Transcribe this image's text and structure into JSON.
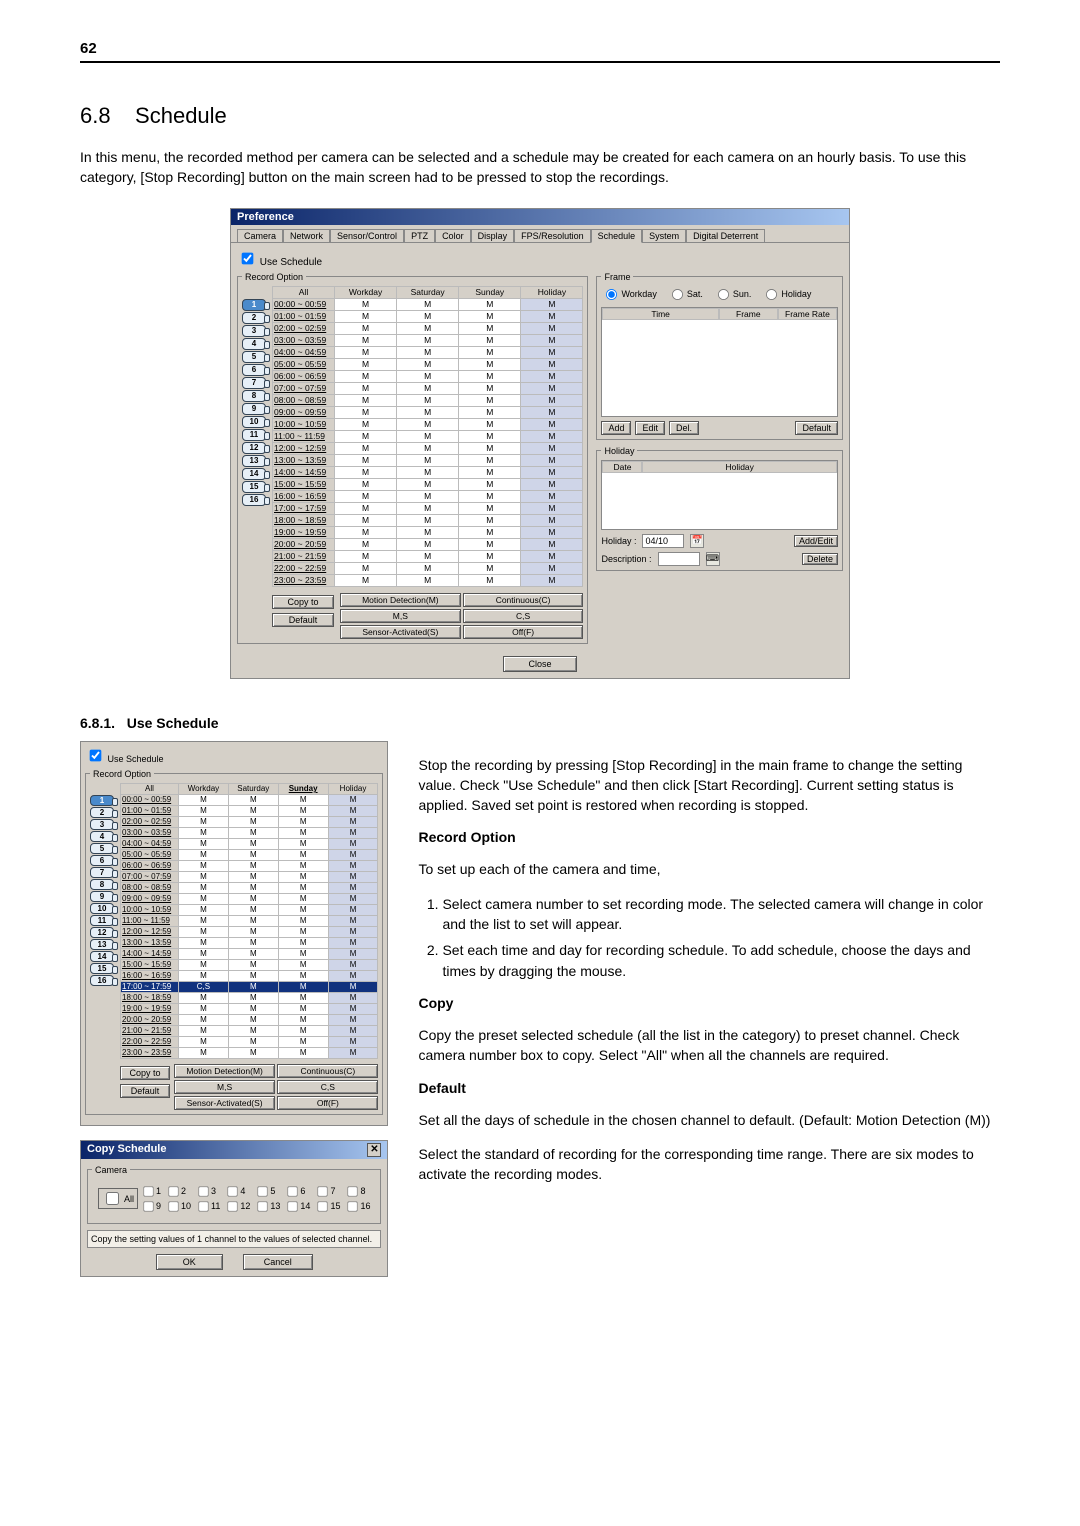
{
  "page_number": "62",
  "section": {
    "num": "6.8",
    "title": "Schedule"
  },
  "intro": "In this menu, the recorded method per camera can be selected and a schedule may be created for each camera on an hourly basis. To use this category, [Stop Recording] button on the main screen had to be pressed to stop the recordings.",
  "subsect": {
    "num": "6.8.1.",
    "title": "Use Schedule"
  },
  "right": {
    "p1": "Stop the recording by pressing [Stop Recording] in the main frame to change the setting value. Check \"Use Schedule\" and then click [Start Recording]. Current setting status is applied. Saved set point is restored when recording is stopped.",
    "record_option_h": "Record Option",
    "record_option_p": "To set up each of the camera and time,",
    "list": [
      "Select camera number to set recording mode. The selected camera will change in color and the list to set will appear.",
      "Set each time and day for recording schedule. To add schedule, choose the days and times by dragging the mouse."
    ],
    "copy_h": "Copy",
    "copy_p": "Copy the preset selected schedule (all the list in the category) to preset channel. Check camera number box to copy. Select \"All\" when all the channels are required.",
    "default_h": "Default",
    "default_p": "Set all the days of schedule in the chosen channel to default. (Default: Motion Detection (M))",
    "tail": "Select the standard of recording for the corresponding time range. There are six modes to activate the recording modes."
  },
  "dialog": {
    "title": "Preference",
    "tabs": [
      "Camera",
      "Network",
      "Sensor/Control",
      "PTZ",
      "Color",
      "Display",
      "FPS/Resolution",
      "Schedule",
      "System",
      "Digital Deterrent"
    ],
    "active_tab": "Schedule",
    "use_schedule": "Use Schedule",
    "record_option": "Record Option",
    "cols": [
      "All",
      "Workday",
      "Saturday",
      "Sunday",
      "Holiday"
    ],
    "copy_to": "Copy to",
    "default_btn": "Default",
    "legend": {
      "md": "Motion Detection(M)",
      "cont": "Continuous(C)",
      "ms": "M,S",
      "cs": "C,S",
      "sa": "Sensor-Activated(S)",
      "off": "Off(F)"
    },
    "frame_grp": "Frame",
    "radios": {
      "workday": "Workday",
      "sat": "Sat.",
      "sun": "Sun.",
      "holiday": "Holiday"
    },
    "frame_cols": {
      "time": "Time",
      "frame": "Frame",
      "rate": "Frame Rate"
    },
    "frame_btns": {
      "add": "Add",
      "edit": "Edit",
      "del": "Del.",
      "default": "Default"
    },
    "holiday_grp": "Holiday",
    "holiday_cols": {
      "date": "Date",
      "holiday": "Holiday"
    },
    "holiday_label": "Holiday :",
    "holiday_value": "04/10",
    "desc_label": "Description :",
    "addedit": "Add/Edit",
    "delete": "Delete",
    "close": "Close"
  },
  "mini_dialog": {
    "selected_row": 17,
    "selected_val": "C,S"
  },
  "copy_dialog": {
    "title": "Copy Schedule",
    "camera_grp": "Camera",
    "all": "All",
    "msg": "Copy the setting values of  1 channel to the values of selected channel.",
    "ok": "OK",
    "cancel": "Cancel"
  },
  "times": [
    "00:00 ~ 00:59",
    "01:00 ~ 01:59",
    "02:00 ~ 02:59",
    "03:00 ~ 03:59",
    "04:00 ~ 04:59",
    "05:00 ~ 05:59",
    "06:00 ~ 06:59",
    "07:00 ~ 07:59",
    "08:00 ~ 08:59",
    "09:00 ~ 09:59",
    "10:00 ~ 10:59",
    "11:00 ~ 11:59",
    "12:00 ~ 12:59",
    "13:00 ~ 13:59",
    "14:00 ~ 14:59",
    "15:00 ~ 15:59",
    "16:00 ~ 16:59",
    "17:00 ~ 17:59",
    "18:00 ~ 18:59",
    "19:00 ~ 19:59",
    "20:00 ~ 20:59",
    "21:00 ~ 21:59",
    "22:00 ~ 22:59",
    "23:00 ~ 23:59"
  ],
  "cam_labels": [
    "1",
    "2",
    "3",
    "4",
    "5",
    "6",
    "7",
    "8",
    "9",
    "10",
    "11",
    "12",
    "13",
    "14",
    "15",
    "16"
  ],
  "cell_value": "M"
}
